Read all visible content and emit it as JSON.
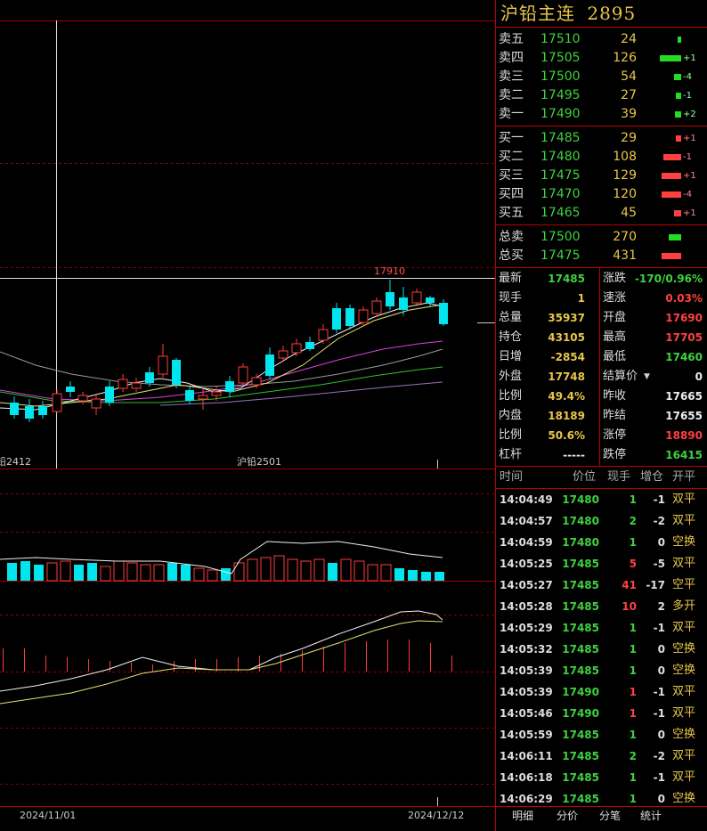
{
  "header": {
    "name": "沪铅主连",
    "code": "2895"
  },
  "sell": [
    {
      "label": "卖五",
      "price": "17510",
      "vol": "24",
      "chg": ""
    },
    {
      "label": "卖四",
      "price": "17505",
      "vol": "126",
      "chg": "+1"
    },
    {
      "label": "卖三",
      "price": "17500",
      "vol": "54",
      "chg": "-4"
    },
    {
      "label": "卖二",
      "price": "17495",
      "vol": "27",
      "chg": "-1"
    },
    {
      "label": "卖一",
      "price": "17490",
      "vol": "39",
      "chg": "+2"
    }
  ],
  "buy": [
    {
      "label": "买一",
      "price": "17485",
      "vol": "29",
      "chg": "+1"
    },
    {
      "label": "买二",
      "price": "17480",
      "vol": "108",
      "chg": "-1"
    },
    {
      "label": "买三",
      "price": "17475",
      "vol": "129",
      "chg": "+1"
    },
    {
      "label": "买四",
      "price": "17470",
      "vol": "120",
      "chg": "-4"
    },
    {
      "label": "买五",
      "price": "17465",
      "vol": "45",
      "chg": "+1"
    }
  ],
  "totals": [
    {
      "label": "总卖",
      "price": "17500",
      "vol": "270"
    },
    {
      "label": "总买",
      "price": "17475",
      "vol": "431"
    }
  ],
  "quote": [
    {
      "l": "最新",
      "lv": "17485",
      "lc": "green",
      "r": "涨跌",
      "rv": "-170/0.96%",
      "rc": "green"
    },
    {
      "l": "现手",
      "lv": "1",
      "lc": "yellow",
      "r": "速涨",
      "rv": "0.03%",
      "rc": "red"
    },
    {
      "l": "总量",
      "lv": "35937",
      "lc": "yellow",
      "r": "开盘",
      "rv": "17690",
      "rc": "red"
    },
    {
      "l": "持仓",
      "lv": "43105",
      "lc": "yellow",
      "r": "最高",
      "rv": "17705",
      "rc": "red"
    },
    {
      "l": "日增",
      "lv": "-2854",
      "lc": "yellow",
      "r": "最低",
      "rv": "17460",
      "rc": "green"
    },
    {
      "l": "外盘",
      "lv": "17748",
      "lc": "yellow",
      "r": "结算价",
      "rv": "0",
      "rc": "white"
    },
    {
      "l": "比例",
      "lv": "49.4%",
      "lc": "yellow",
      "r": "昨收",
      "rv": "17665",
      "rc": "white"
    },
    {
      "l": "内盘",
      "lv": "18189",
      "lc": "yellow",
      "r": "昨结",
      "rv": "17655",
      "rc": "white"
    },
    {
      "l": "比例",
      "lv": "50.6%",
      "lc": "yellow",
      "r": "涨停",
      "rv": "18890",
      "rc": "red"
    },
    {
      "l": "杠杆",
      "lv": "-----",
      "lc": "white",
      "r": "跌停",
      "rv": "16415",
      "rc": "green"
    }
  ],
  "ticks_header": {
    "time": "时间",
    "price": "价位",
    "vol": "现手",
    "chg": "增仓",
    "type": "开平"
  },
  "ticks": [
    {
      "t": "14:04:49",
      "p": "17480",
      "pc": "green",
      "v": "1",
      "vc": "green",
      "c": "-1",
      "k": "双平"
    },
    {
      "t": "14:04:57",
      "p": "17480",
      "pc": "green",
      "v": "2",
      "vc": "green",
      "c": "-2",
      "k": "双平"
    },
    {
      "t": "14:04:59",
      "p": "17480",
      "pc": "green",
      "v": "1",
      "vc": "green",
      "c": "0",
      "k": "空换"
    },
    {
      "t": "14:05:25",
      "p": "17485",
      "pc": "green",
      "v": "5",
      "vc": "red",
      "c": "-5",
      "k": "双平"
    },
    {
      "t": "14:05:27",
      "p": "17485",
      "pc": "green",
      "v": "41",
      "vc": "red",
      "c": "-17",
      "k": "空平"
    },
    {
      "t": "14:05:28",
      "p": "17485",
      "pc": "green",
      "v": "10",
      "vc": "red",
      "c": "2",
      "k": "多开"
    },
    {
      "t": "14:05:29",
      "p": "17485",
      "pc": "green",
      "v": "1",
      "vc": "green",
      "c": "-1",
      "k": "双平"
    },
    {
      "t": "14:05:32",
      "p": "17485",
      "pc": "green",
      "v": "1",
      "vc": "green",
      "c": "0",
      "k": "空换"
    },
    {
      "t": "14:05:39",
      "p": "17485",
      "pc": "green",
      "v": "1",
      "vc": "green",
      "c": "0",
      "k": "空换"
    },
    {
      "t": "14:05:39",
      "p": "17490",
      "pc": "green",
      "v": "1",
      "vc": "red",
      "c": "-1",
      "k": "双平"
    },
    {
      "t": "14:05:46",
      "p": "17490",
      "pc": "green",
      "v": "1",
      "vc": "red",
      "c": "-1",
      "k": "双平"
    },
    {
      "t": "14:05:59",
      "p": "17485",
      "pc": "green",
      "v": "1",
      "vc": "green",
      "c": "0",
      "k": "空换"
    },
    {
      "t": "14:06:11",
      "p": "17485",
      "pc": "green",
      "v": "2",
      "vc": "green",
      "c": "-2",
      "k": "双平"
    },
    {
      "t": "14:06:18",
      "p": "17485",
      "pc": "green",
      "v": "1",
      "vc": "green",
      "c": "-1",
      "k": "双平"
    },
    {
      "t": "14:06:29",
      "p": "17485",
      "pc": "green",
      "v": "1",
      "vc": "green",
      "c": "0",
      "k": "空换"
    }
  ],
  "tabs": [
    "明细",
    "分价",
    "分笔",
    "统计"
  ],
  "chart_labels": {
    "high": "17910",
    "contract_left": "铅2412",
    "contract_mid": "沪铅2501",
    "date_left": "2024/11/01",
    "date_right": "2024/12/12"
  },
  "colors": {
    "up": "#ff3b3b",
    "down": "#00e5ee",
    "grid": "#a00000",
    "price_green": "#3fd13f",
    "label_yellow": "#e8c64a"
  }
}
